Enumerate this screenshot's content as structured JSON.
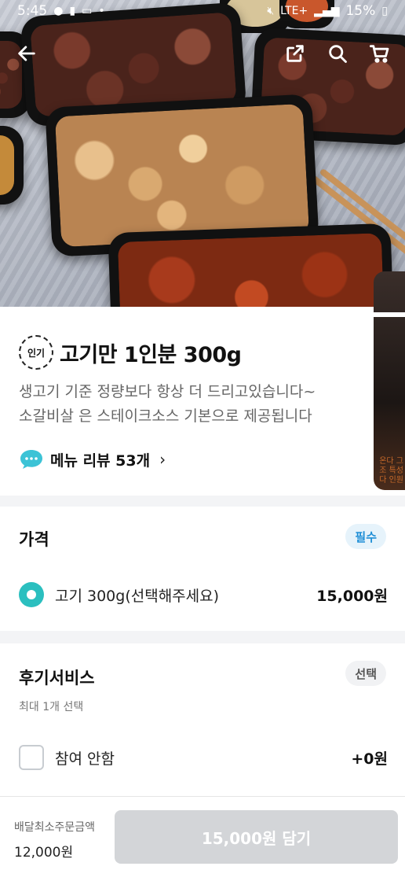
{
  "status_bar": {
    "time": "5:45",
    "battery": "15%",
    "network": "LTE+"
  },
  "nav": {
    "back_icon": "arrow-left-icon",
    "share_icon": "share-icon",
    "search_icon": "search-icon",
    "cart_icon": "cart-icon"
  },
  "menu": {
    "badge": "인기",
    "title": "고기만 1인분 300g",
    "description_line1": "생고기 기준 정량보다 항상 더 드리고있습니다~",
    "description_line2": "소갈비살 은 스테이크소스 기본으로 제공됩니다",
    "review_label": "메뉴 리뷰 53개",
    "review_icon": "speech-bubble-icon"
  },
  "side_thumb_text": "온다 그\n조 특성\n다 인원",
  "price_section": {
    "title": "가격",
    "badge": "필수",
    "option_label": "고기 300g(선택해주세요)",
    "option_price": "15,000원",
    "selected": true
  },
  "review_section": {
    "title": "후기서비스",
    "badge": "선택",
    "subtitle": "최대 1개 선택",
    "option_label": "참여 안함",
    "option_price": "+0원",
    "checked": false
  },
  "bottom_bar": {
    "min_order_label": "배달최소주문금액",
    "min_order_value": "12,000원",
    "cart_button": "15,000원 담기"
  },
  "colors": {
    "accent_teal": "#2bbfbf",
    "required_blue": "#1f8fd6",
    "disabled_button": "#d3d5d8"
  }
}
